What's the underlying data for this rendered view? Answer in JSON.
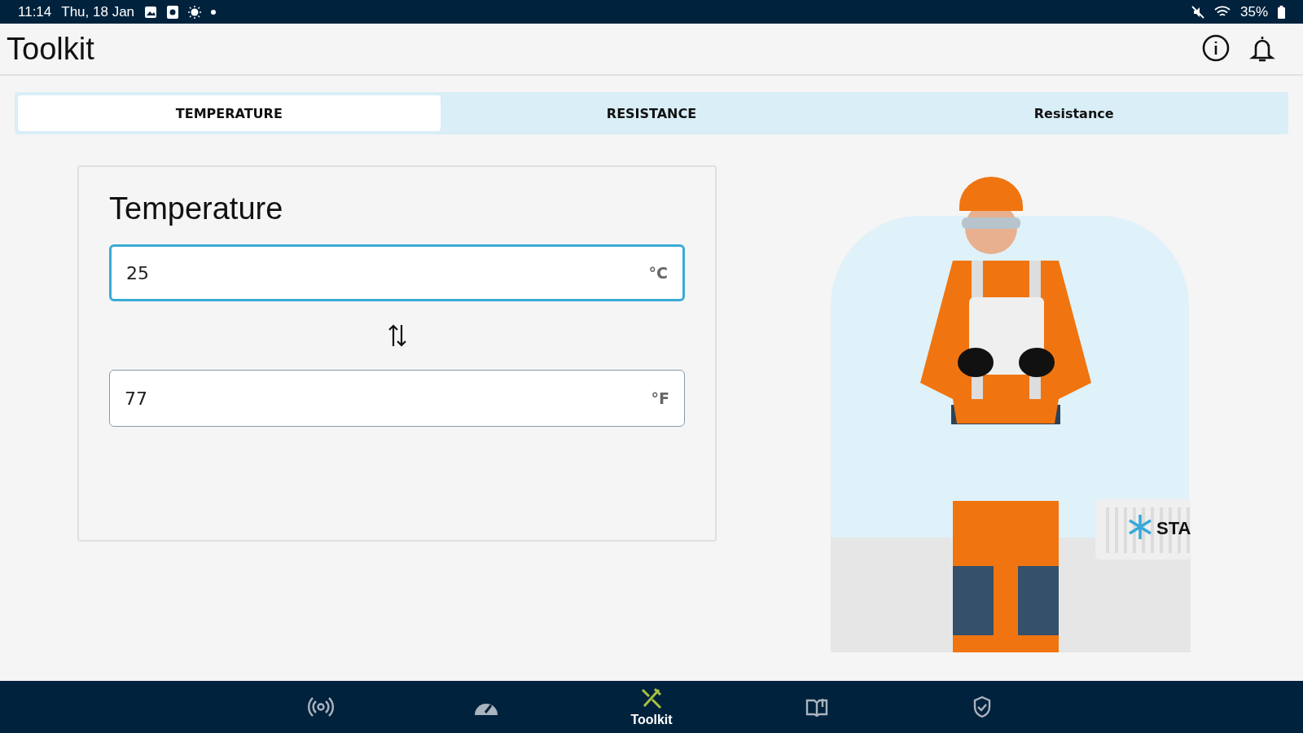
{
  "status_bar": {
    "time": "11:14",
    "date": "Thu, 18 Jan",
    "battery": "35%"
  },
  "app_bar": {
    "title": "Toolkit"
  },
  "tabs": [
    {
      "label": "TEMPERATURE",
      "selected": true
    },
    {
      "label": "RESISTANCE",
      "selected": false
    },
    {
      "label": "Resistance",
      "selected": false
    }
  ],
  "converter": {
    "title": "Temperature",
    "fields": [
      {
        "value": "25",
        "unit": "°C",
        "focused": true
      },
      {
        "value": "77",
        "unit": "°F",
        "focused": false
      }
    ]
  },
  "illustration": {
    "container_label": "STA"
  },
  "bottom_nav": [
    {
      "kind": "signal",
      "selected": false
    },
    {
      "kind": "gauge",
      "selected": false
    },
    {
      "kind": "tools",
      "selected": true,
      "label": "Toolkit"
    },
    {
      "kind": "book",
      "selected": false
    },
    {
      "kind": "shield",
      "selected": false
    }
  ]
}
